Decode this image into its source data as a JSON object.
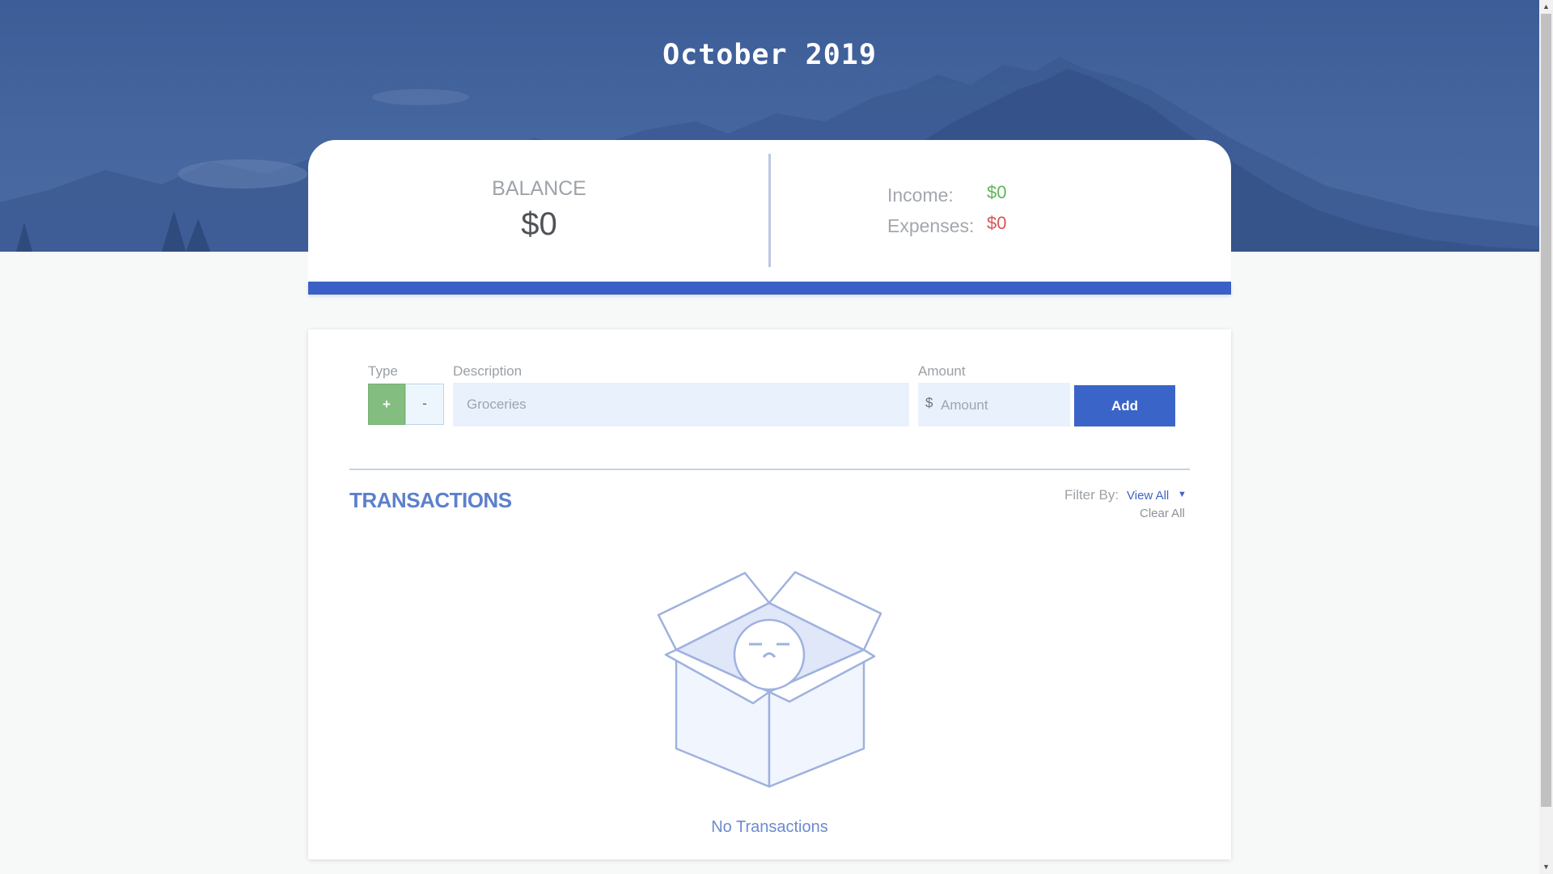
{
  "header": {
    "title": "October 2019"
  },
  "summary": {
    "balance_label": "BALANCE",
    "balance_value": "$0",
    "income_label": "Income:",
    "income_value": "$0",
    "expenses_label": "Expenses:",
    "expenses_value": "$0"
  },
  "form": {
    "type_label": "Type",
    "type_plus": "+",
    "type_minus": "-",
    "description_label": "Description",
    "description_placeholder": "Groceries",
    "amount_label": "Amount",
    "currency_symbol": "$",
    "amount_placeholder": "Amount",
    "add_button": "Add"
  },
  "transactions": {
    "title": "TRANSACTIONS",
    "filter_label": "Filter By:",
    "filter_value": "View All",
    "clear_all": "Clear All",
    "empty_text": "No Transactions",
    "empty_icon": "sad-box-icon"
  },
  "colors": {
    "header_bg": "#46669f",
    "accent_blue": "#3a60c5",
    "income_green": "#5fb45a",
    "expense_red": "#d65555"
  }
}
